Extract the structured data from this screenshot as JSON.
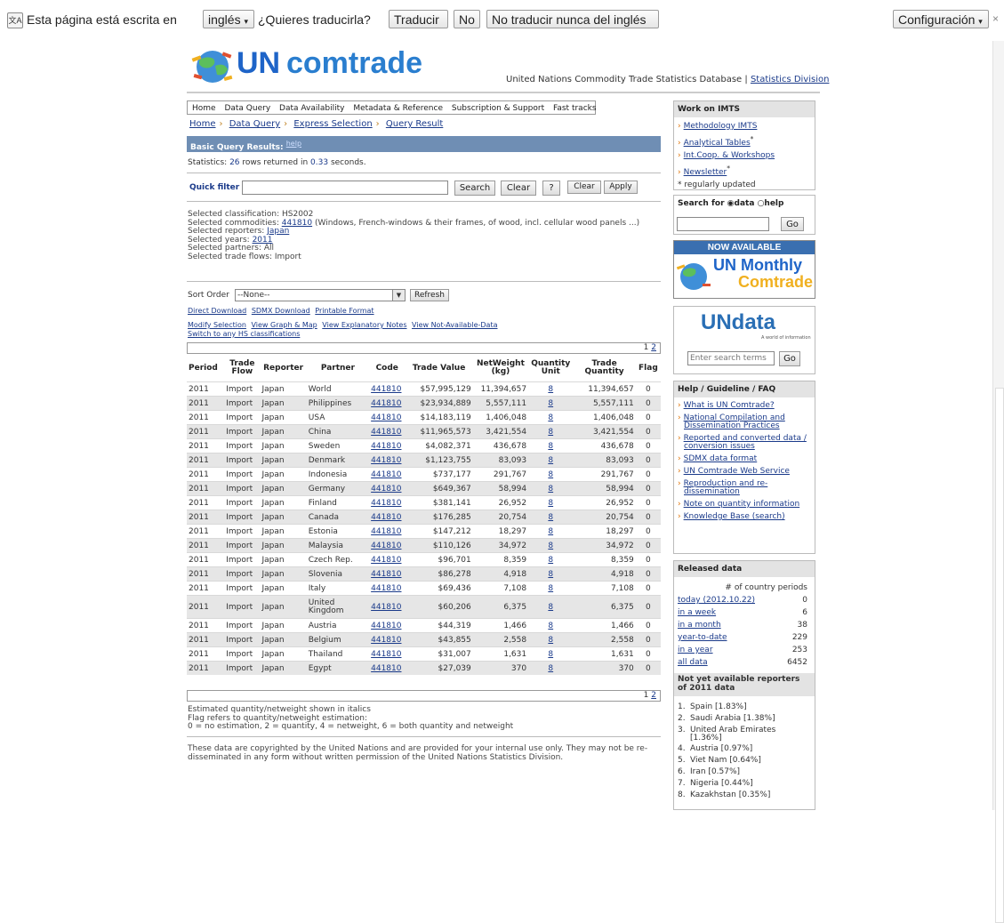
{
  "translate_bar": {
    "prefix": "Esta página está escrita en",
    "language": "inglés",
    "question": "¿Quieres traducirla?",
    "translate_btn": "Traducir",
    "no_btn": "No",
    "never_btn": "No traducir nunca del inglés",
    "config_btn": "Configuración",
    "close": "×"
  },
  "header": {
    "logo_un": "UN",
    "logo_comtrade": "comtrade",
    "tagline": "United Nations Commodity Trade Statistics Database |",
    "division_link": "Statistics Division"
  },
  "nav": [
    "Home",
    "Data Query",
    "Data Availability",
    "Metadata & Reference",
    "Subscription & Support",
    "Fast tracks"
  ],
  "breadcrumb": [
    "Home",
    "Data Query",
    "Express Selection",
    "Query Result"
  ],
  "results": {
    "title": "Basic Query Results:",
    "help": "help",
    "stats_prefix": "Statistics:",
    "rows": "26",
    "rows_mid": "rows returned in",
    "seconds": "0.33",
    "seconds_suffix": "seconds."
  },
  "filter": {
    "label": "Quick filter",
    "search": "Search",
    "clear": "Clear",
    "help": "?",
    "clear2": "Clear",
    "apply": "Apply"
  },
  "selection": {
    "classification": "Selected classification: HS2002",
    "commodities_prefix": "Selected commodities:",
    "commodity_code": "441810",
    "commodity_desc": "(Windows, French-windows & their frames, of wood, incl. cellular wood panels ...)",
    "reporters_prefix": "Selected reporters:",
    "reporter": "Japan",
    "years_prefix": "Selected years:",
    "year": "2011",
    "partners": "Selected partners: All",
    "flows": "Selected trade flows: Import"
  },
  "sort": {
    "label": "Sort Order",
    "value": "--None--",
    "refresh": "Refresh"
  },
  "links": {
    "row1": [
      "Direct Download",
      "SDMX Download",
      "Printable Format"
    ],
    "row2": [
      "Modify Selection",
      "View Graph & Map",
      "View Explanatory Notes",
      "View Not-Available-Data"
    ],
    "row3": "Switch to any HS classifications"
  },
  "pager": {
    "p1": "1",
    "p2": "2"
  },
  "table": {
    "headers": [
      "Period",
      "Trade Flow",
      "Reporter",
      "Partner",
      "Code",
      "Trade Value",
      "NetWeight (kg)",
      "Quantity Unit",
      "Trade Quantity",
      "Flag"
    ],
    "rows": [
      [
        "2011",
        "Import",
        "Japan",
        "World",
        "441810",
        "$57,995,129",
        "11,394,657",
        "8",
        "11,394,657",
        "0"
      ],
      [
        "2011",
        "Import",
        "Japan",
        "Philippines",
        "441810",
        "$23,934,889",
        "5,557,111",
        "8",
        "5,557,111",
        "0"
      ],
      [
        "2011",
        "Import",
        "Japan",
        "USA",
        "441810",
        "$14,183,119",
        "1,406,048",
        "8",
        "1,406,048",
        "0"
      ],
      [
        "2011",
        "Import",
        "Japan",
        "China",
        "441810",
        "$11,965,573",
        "3,421,554",
        "8",
        "3,421,554",
        "0"
      ],
      [
        "2011",
        "Import",
        "Japan",
        "Sweden",
        "441810",
        "$4,082,371",
        "436,678",
        "8",
        "436,678",
        "0"
      ],
      [
        "2011",
        "Import",
        "Japan",
        "Denmark",
        "441810",
        "$1,123,755",
        "83,093",
        "8",
        "83,093",
        "0"
      ],
      [
        "2011",
        "Import",
        "Japan",
        "Indonesia",
        "441810",
        "$737,177",
        "291,767",
        "8",
        "291,767",
        "0"
      ],
      [
        "2011",
        "Import",
        "Japan",
        "Germany",
        "441810",
        "$649,367",
        "58,994",
        "8",
        "58,994",
        "0"
      ],
      [
        "2011",
        "Import",
        "Japan",
        "Finland",
        "441810",
        "$381,141",
        "26,952",
        "8",
        "26,952",
        "0"
      ],
      [
        "2011",
        "Import",
        "Japan",
        "Canada",
        "441810",
        "$176,285",
        "20,754",
        "8",
        "20,754",
        "0"
      ],
      [
        "2011",
        "Import",
        "Japan",
        "Estonia",
        "441810",
        "$147,212",
        "18,297",
        "8",
        "18,297",
        "0"
      ],
      [
        "2011",
        "Import",
        "Japan",
        "Malaysia",
        "441810",
        "$110,126",
        "34,972",
        "8",
        "34,972",
        "0"
      ],
      [
        "2011",
        "Import",
        "Japan",
        "Czech Rep.",
        "441810",
        "$96,701",
        "8,359",
        "8",
        "8,359",
        "0"
      ],
      [
        "2011",
        "Import",
        "Japan",
        "Slovenia",
        "441810",
        "$86,278",
        "4,918",
        "8",
        "4,918",
        "0"
      ],
      [
        "2011",
        "Import",
        "Japan",
        "Italy",
        "441810",
        "$69,436",
        "7,108",
        "8",
        "7,108",
        "0"
      ],
      [
        "2011",
        "Import",
        "Japan",
        "United Kingdom",
        "441810",
        "$60,206",
        "6,375",
        "8",
        "6,375",
        "0"
      ],
      [
        "2011",
        "Import",
        "Japan",
        "Austria",
        "441810",
        "$44,319",
        "1,466",
        "8",
        "1,466",
        "0"
      ],
      [
        "2011",
        "Import",
        "Japan",
        "Belgium",
        "441810",
        "$43,855",
        "2,558",
        "8",
        "2,558",
        "0"
      ],
      [
        "2011",
        "Import",
        "Japan",
        "Thailand",
        "441810",
        "$31,007",
        "1,631",
        "8",
        "1,631",
        "0"
      ],
      [
        "2011",
        "Import",
        "Japan",
        "Egypt",
        "441810",
        "$27,039",
        "370",
        "8",
        "370",
        "0"
      ]
    ]
  },
  "notes": [
    "Estimated quantity/netweight shown in italics",
    "Flag refers to quantity/netweight estimation:",
    "0 = no estimation, 2 = quantity, 4 = netweight, 6 = both quantity and netweight"
  ],
  "copyright": "These data are copyrighted by the United Nations and are provided for your internal use only. They may not be re-disseminated in any form without written permission of the United Nations Statistics Division.",
  "sidebar": {
    "imts": {
      "title": "Work on IMTS",
      "items": [
        "Methodology IMTS",
        "Analytical Tables",
        "Int.Coop. & Workshops",
        "Newsletter"
      ],
      "star": "*",
      "note": "* regularly updated"
    },
    "search": {
      "label": "Search for",
      "opt_data": "data",
      "opt_help": "help",
      "go": "Go"
    },
    "monthly": {
      "top": "NOW AVAILABLE",
      "line1": "UN Monthly",
      "line2": "Comtrade"
    },
    "undata": {
      "logo": "UNdata",
      "sub": "A world of information",
      "placeholder": "Enter search terms",
      "go": "Go"
    },
    "help": {
      "title": "Help / Guideline / FAQ",
      "items": [
        "What is UN Comtrade?",
        "National Compilation and Dissemination Practices",
        "Reported and converted data / conversion issues",
        "SDMX data format",
        "UN Comtrade Web Service",
        "Reproduction and re-dissemination",
        "Note on quantity information",
        "Knowledge Base (search)"
      ]
    },
    "released": {
      "title": "Released data",
      "col_header": "# of country periods",
      "rows": [
        [
          "today (2012.10.22)",
          "0"
        ],
        [
          "in a week",
          "6"
        ],
        [
          "in a month",
          "38"
        ],
        [
          "year-to-date",
          "229"
        ],
        [
          "in a year",
          "253"
        ],
        [
          "all data",
          "6452"
        ]
      ]
    },
    "notyet": {
      "title": "Not yet available reporters of 2011 data",
      "items": [
        "Spain [1.83%]",
        "Saudi Arabia [1.38%]",
        "United Arab Emirates [1.36%]",
        "Austria [0.97%]",
        "Viet Nam [0.64%]",
        "Iran [0.57%]",
        "Nigeria [0.44%]",
        "Kazakhstan [0.35%]"
      ]
    }
  },
  "colors": {
    "accent": "#6f8eb4",
    "link": "#1a3a8a",
    "arrow": "#e07000",
    "logo_blue": "#1e64c8"
  }
}
